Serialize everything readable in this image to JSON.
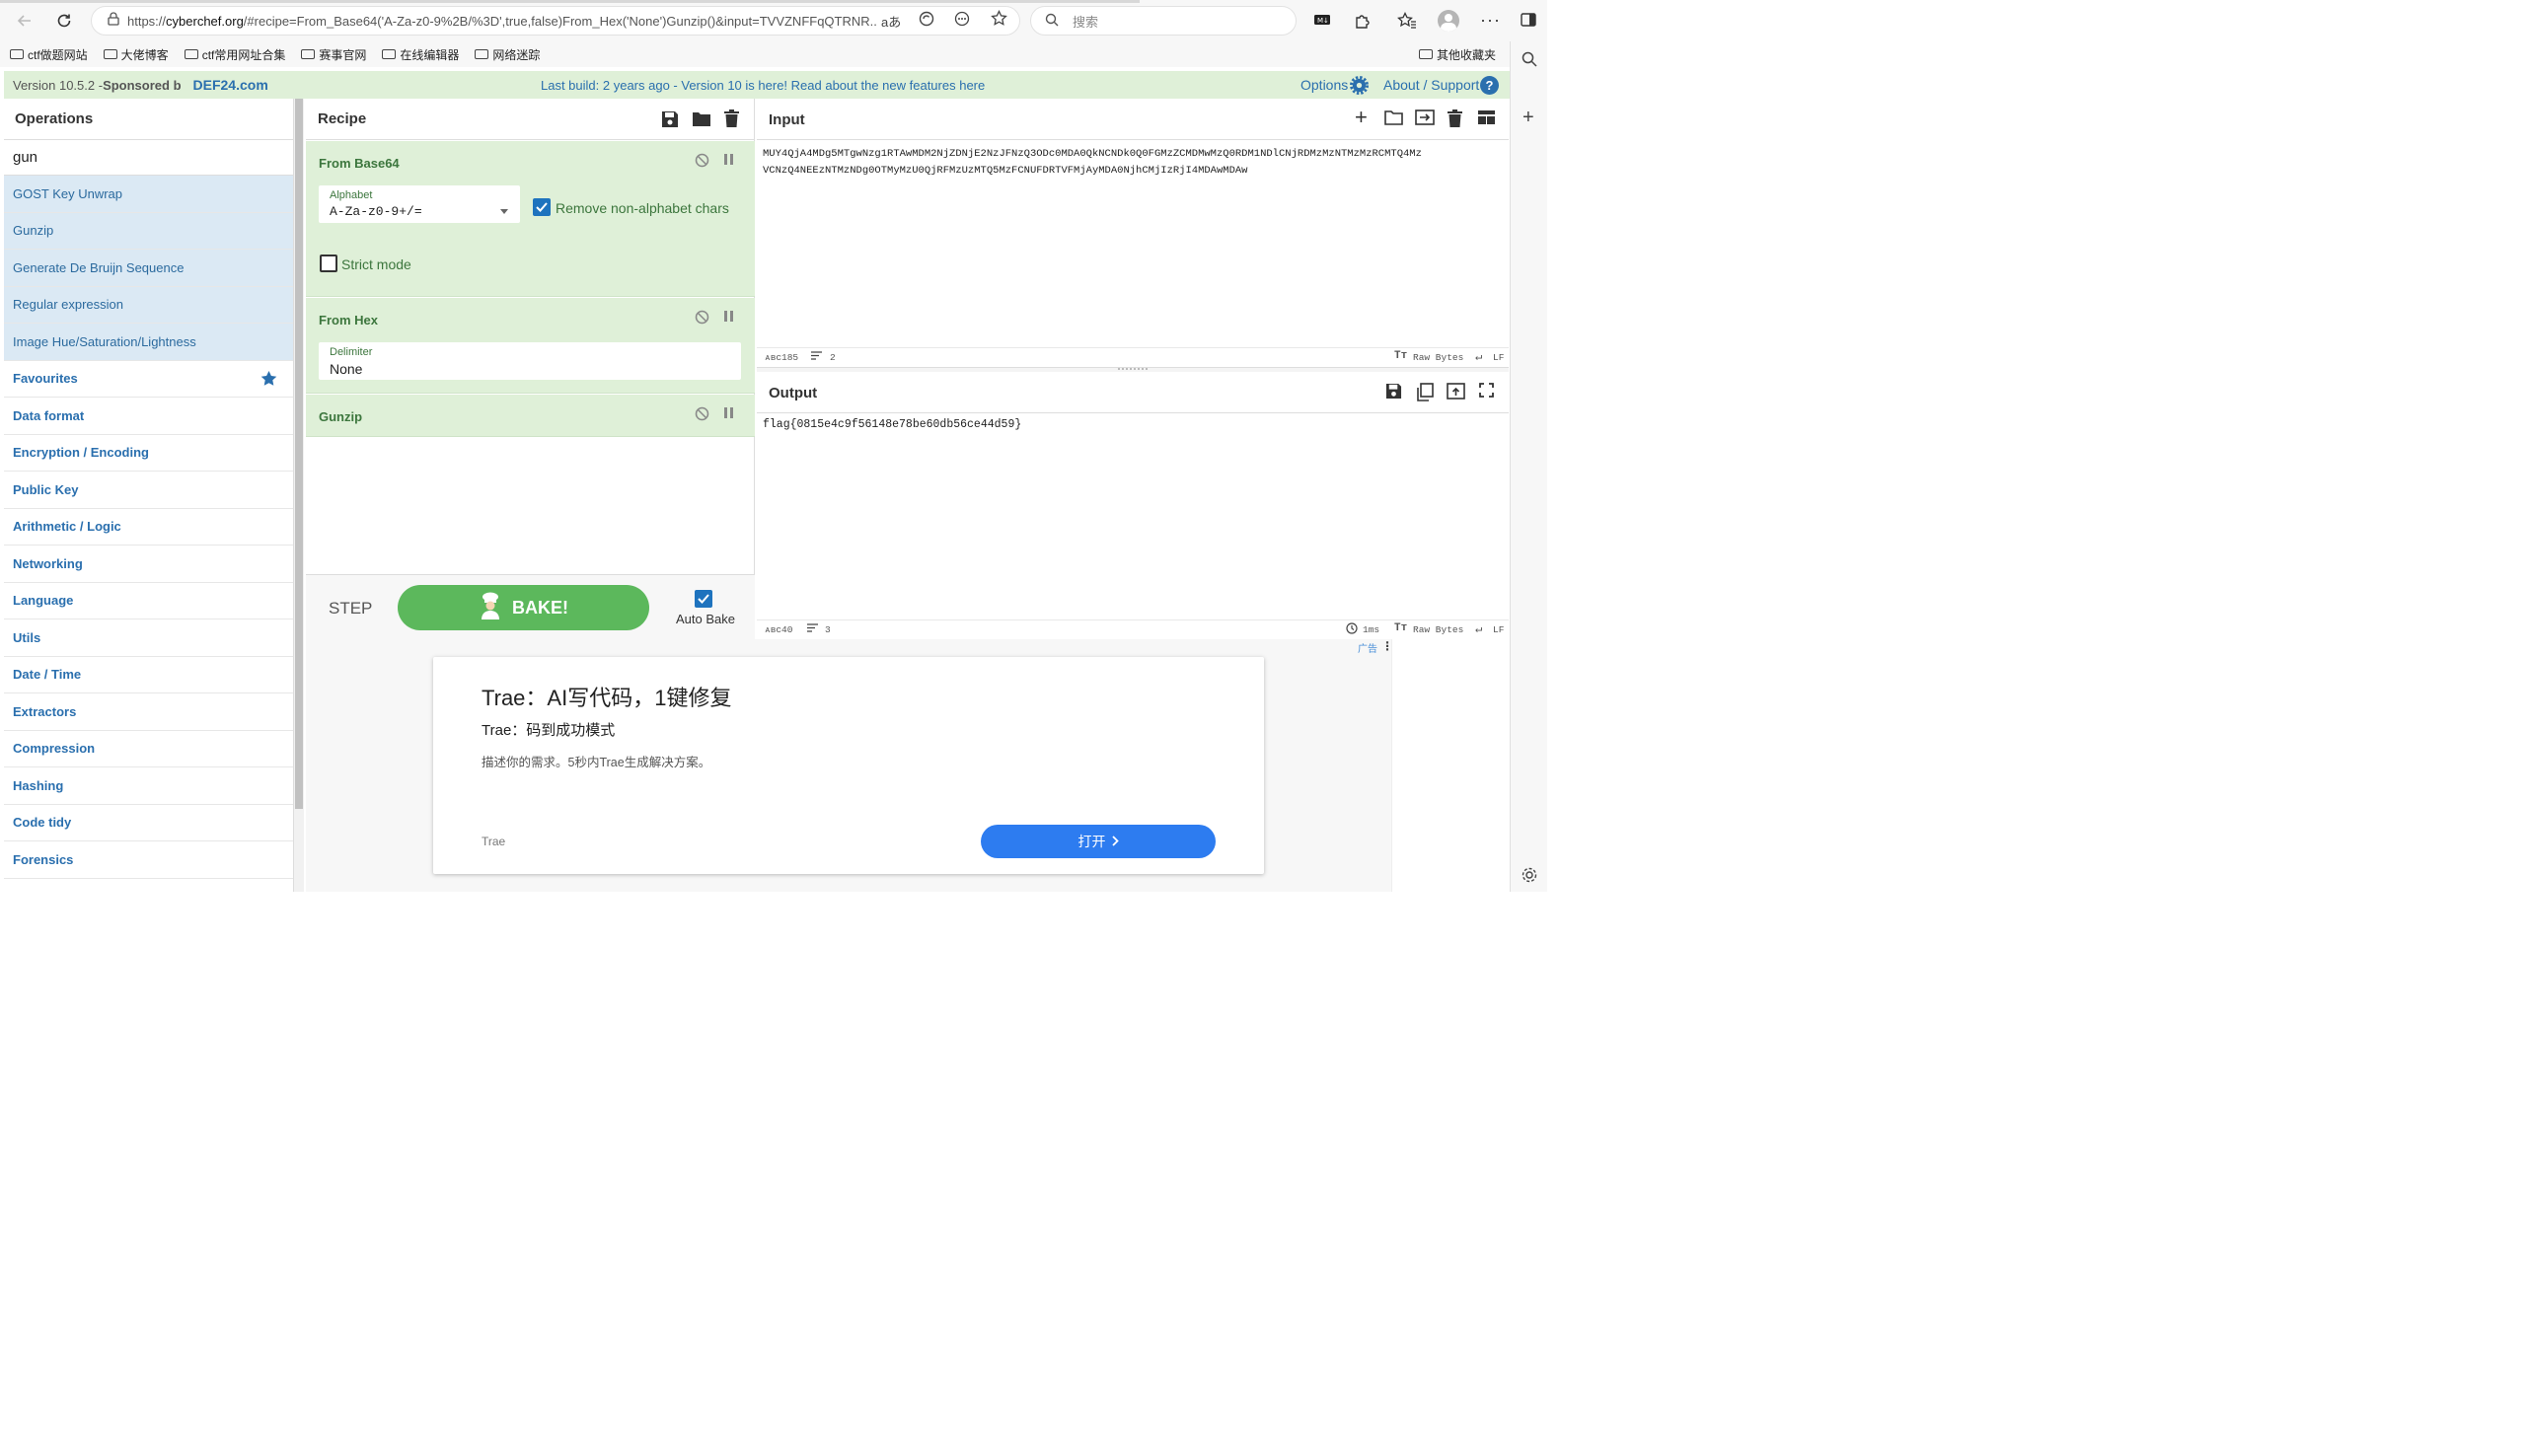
{
  "browser": {
    "url_prefix": "https://",
    "url_host": "cyberchef.org",
    "url_rest": "/#recipe=From_Base64('A-Za-z0-9%2B/%3D',true,false)From_Hex('None')Gunzip()&input=TVVZNFFqQTRNR...",
    "search_placeholder": "搜索",
    "read_aloud_label": "aあ",
    "bookmarks": [
      "ctf做题网站",
      "大佬博客",
      "ctf常用网址合集",
      "赛事官网",
      "在线编辑器",
      "网络迷踪"
    ],
    "other_bookmarks": "其他收藏夹"
  },
  "banner": {
    "version": "Version 10.5.2 - ",
    "sponsored": "Sponsored b",
    "sponsor_link": "DEF24.com",
    "build_text": "Last build: 2 years ago - Version 10 is here! Read about the new features ",
    "here_link": "here",
    "options_label": "Options",
    "about_label": "About / Support"
  },
  "operations": {
    "title": "Operations",
    "search_value": "gun",
    "results": [
      "GOST Key Unwrap",
      "Gunzip",
      "Generate De Bruijn Sequence",
      "Regular expression",
      "Image Hue/Saturation/Lightness"
    ],
    "categories": [
      "Favourites",
      "Data format",
      "Encryption / Encoding",
      "Public Key",
      "Arithmetic / Logic",
      "Networking",
      "Language",
      "Utils",
      "Date / Time",
      "Extractors",
      "Compression",
      "Hashing",
      "Code tidy",
      "Forensics"
    ]
  },
  "recipe": {
    "title": "Recipe",
    "ops": [
      {
        "name": "From Base64",
        "alphabet_label": "Alphabet",
        "alphabet_value": "A-Za-z0-9+/=",
        "remove_label": "Remove non-alphabet chars",
        "remove_checked": true,
        "strict_label": "Strict mode",
        "strict_checked": false
      },
      {
        "name": "From Hex",
        "delimiter_label": "Delimiter",
        "delimiter_value": "None"
      },
      {
        "name": "Gunzip"
      }
    ],
    "step_label": "STEP",
    "bake_label": "BAKE!",
    "auto_bake_label": "Auto Bake",
    "auto_bake_checked": true
  },
  "input": {
    "title": "Input",
    "line1": "MUY4QjA4MDg5MTgwNzg1RTAwMDM2NjZDNjE2NzJFNzQ3ODc0MDA0QkNCNDk0Q0FGMzZCMDMwMzQ0RDM1NDlCNjRDMzMzNTMzMzRCMTQ4Mz",
    "line2": "VCNzQ4NEEzNTMzNDg0OTMyMzU0QjRFMzUzMTQ5MzFCNUFDRTVFMjAyMDA0NjhCMjIzRjI4MDAwMDAw",
    "length": "185",
    "lines": "2",
    "raw_bytes": "Raw Bytes",
    "eol": "LF"
  },
  "output": {
    "title": "Output",
    "text": "flag{0815e4c9f56148e78be60db56ce44d59}",
    "length": "40",
    "lines": "3",
    "time": "1ms",
    "raw_bytes": "Raw Bytes",
    "eol": "LF"
  },
  "ad": {
    "ad_label": "广告",
    "headline": "Trae：AI写代码，1键修复",
    "subheadline": "Trae：码到成功模式",
    "description": "描述你的需求。5秒内Trae生成解决方案。",
    "brand": "Trae",
    "cta": "打开"
  },
  "colors": {
    "banner_bg": "#dff0d8",
    "recipe_op_bg": "#dff0d8",
    "search_result_bg": "#dbe9f4",
    "category_text": "#2a6fae",
    "bake_green": "#5cb85c",
    "checkbox_blue": "#1e73be",
    "ad_button": "#2d7cf0"
  }
}
